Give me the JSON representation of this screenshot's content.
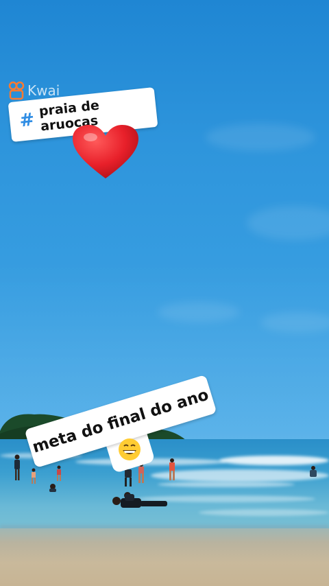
{
  "watermark": {
    "brand": "Kwai"
  },
  "hashtag_sticker": {
    "symbol": "#",
    "text": "praia de aruocas"
  },
  "caption_sticker": {
    "text": "meta do final do ano",
    "emoji": "grinning-face-icon"
  },
  "heart": {
    "icon": "red-heart-icon",
    "color": "#e8202a"
  },
  "colors": {
    "sky": "#2e95dc",
    "sea": "#3b9fd0",
    "sand": "#c9b99b",
    "hashtag": "#2f8de4"
  }
}
